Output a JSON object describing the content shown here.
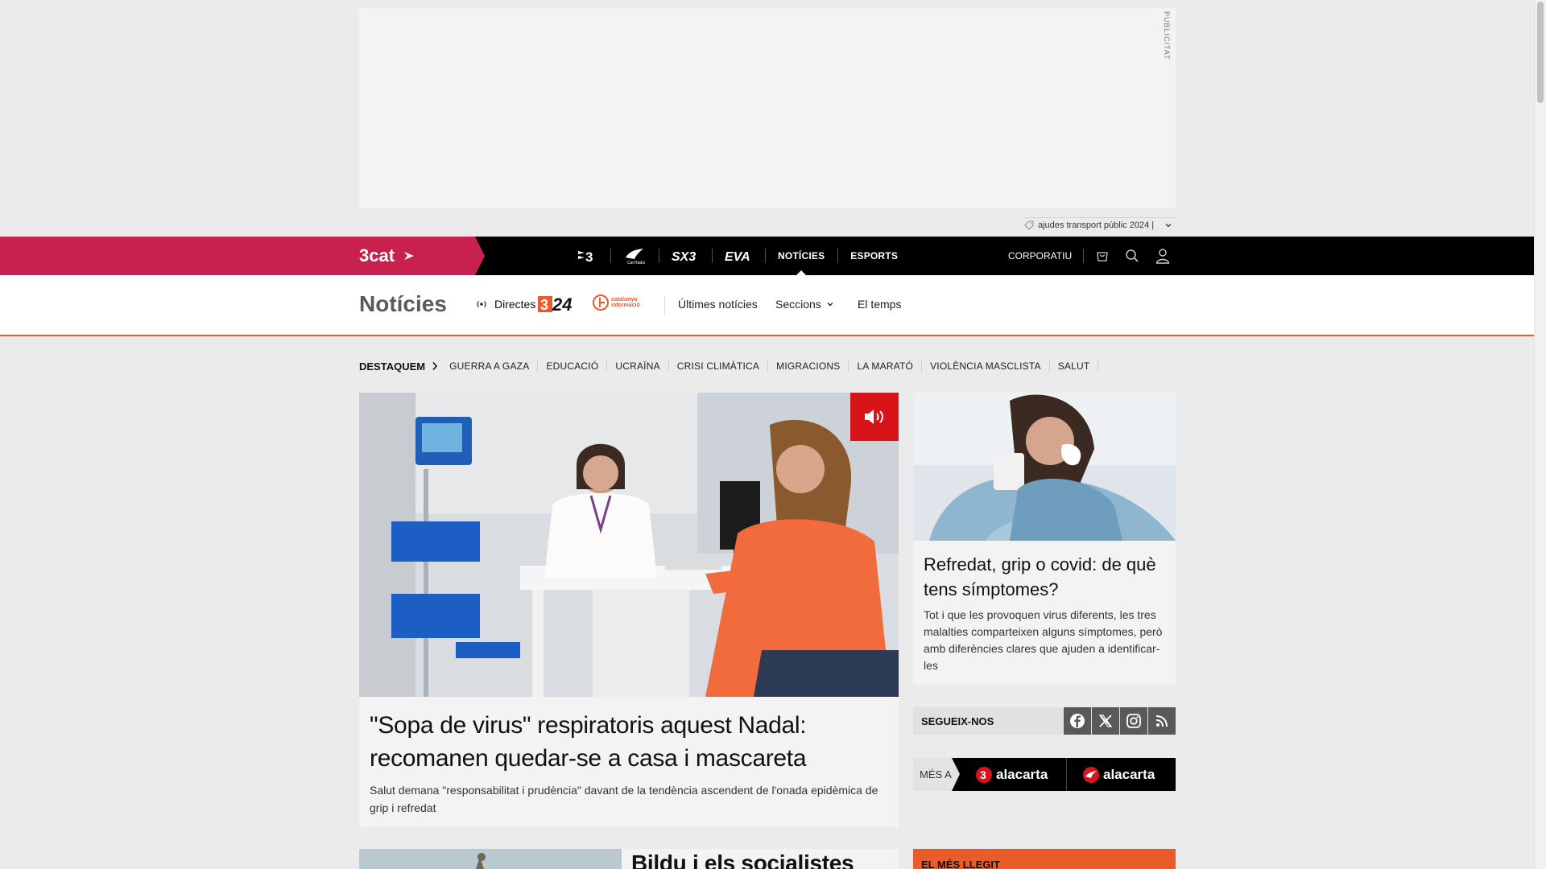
{
  "ad": {
    "label": "PUBLICITAT",
    "strip_text": "ajudes transport públic 2024 |"
  },
  "topbar": {
    "brand": "3cat",
    "channels": [
      {
        "name": "tv3",
        "label": "TV3"
      },
      {
        "name": "catradio",
        "label": "Cat Ràdio"
      },
      {
        "name": "sx3",
        "label": "SX3"
      },
      {
        "name": "eva",
        "label": "EVA"
      },
      {
        "name": "noticies",
        "label": "NOTÍCIES",
        "active": true
      },
      {
        "name": "esports",
        "label": "ESPORTS"
      }
    ],
    "corporate": "CORPORATIU",
    "icons": [
      "cart-icon",
      "search-icon",
      "user-icon"
    ]
  },
  "section": {
    "title": "Notícies",
    "directes": "Directes",
    "logo_324": "324",
    "logo_cat_info_line1": "catalunya",
    "logo_cat_info_line2": "informació",
    "links": {
      "ultimes": "Últimes notícies",
      "seccions": "Seccions",
      "temps": "El temps"
    }
  },
  "tags": {
    "lead": "DESTAQUEM",
    "items": [
      "GUERRA A GAZA",
      "EDUCACIÓ",
      "UCRAÏNA",
      "CRISI CLIMÀTICA",
      "MIGRACIONS",
      "LA MARATÓ",
      "VIOLÈNCIA MASCLISTA",
      "SALUT"
    ]
  },
  "main_article": {
    "title": "\"Sopa de virus\" respiratoris aquest Nadal: recomanen quedar-se a casa i mascareta",
    "summary": "Salut demana \"responsabilitat i prudència\" davant de la tendència ascendent de l'onada epidèmica de grip i refredat"
  },
  "side_article": {
    "title": "Refredat, grip o covid: de què tens símptomes?",
    "summary": "Tot i que les provoquen virus diferents, les tres malalties comparteixen alguns símptomes, però amb diferències clares que ajuden a identificar-les"
  },
  "follow": {
    "label": "SEGUEIX-NOS",
    "networks": [
      "facebook-icon",
      "x-icon",
      "instagram-icon",
      "rss-icon"
    ]
  },
  "alacarta": {
    "label": "MÉS A",
    "items": [
      {
        "prefix": "3",
        "text": "alacarta"
      },
      {
        "prefix": "cat",
        "text": "alacarta"
      }
    ]
  },
  "next_article": {
    "title": "Bildu i els socialistes"
  },
  "most_read": {
    "label": "EL MÉS LLEGIT"
  },
  "colors": {
    "brand_pink": "#c8204f",
    "accent_orange": "#e95c2a",
    "audio_red": "#d7141a"
  }
}
